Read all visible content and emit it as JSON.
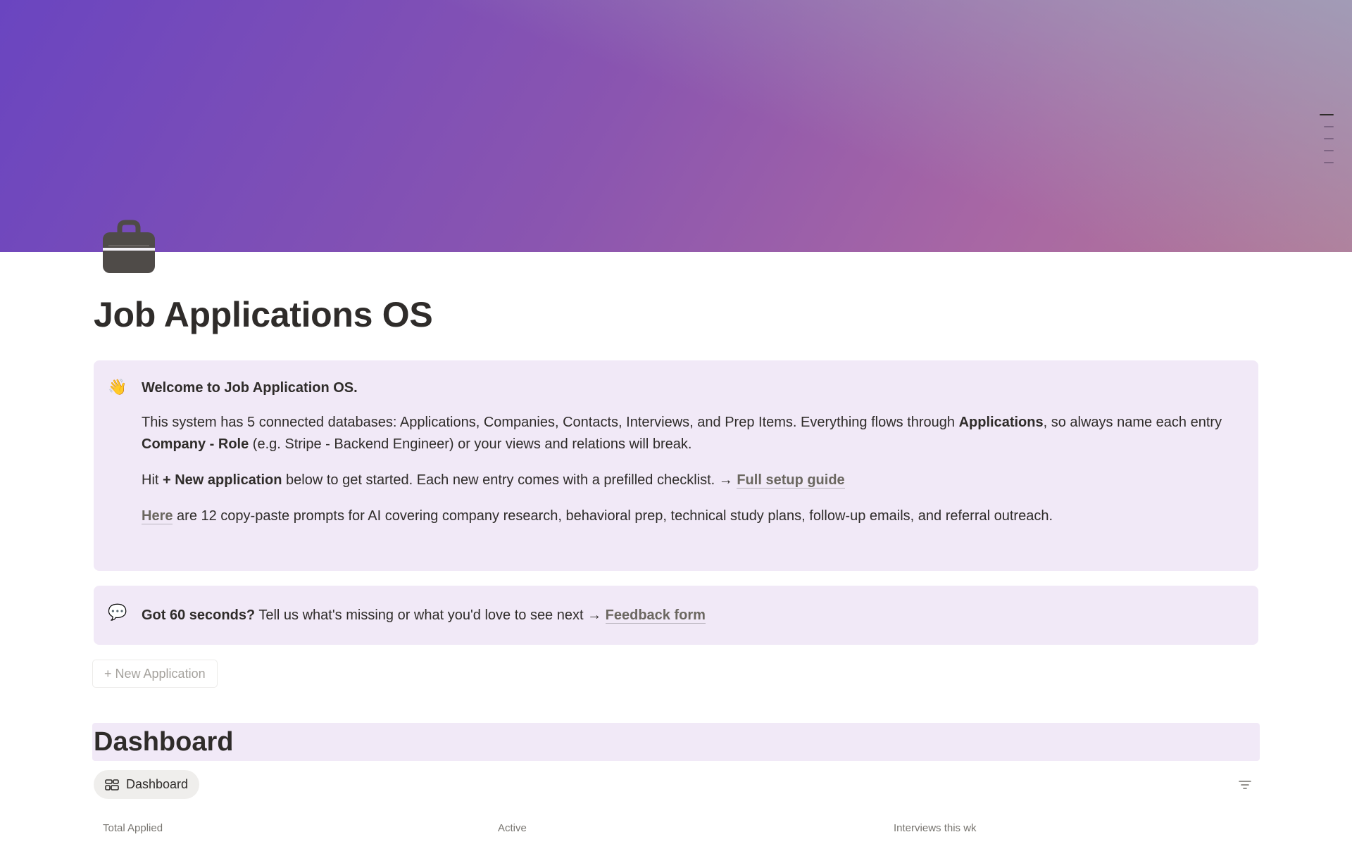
{
  "cover": {
    "toc_items": 5
  },
  "page": {
    "icon": "briefcase-icon",
    "title": "Job Applications OS"
  },
  "welcome_callout": {
    "emoji": "👋",
    "heading": "Welcome to Job Application OS.",
    "p1_a": "This system has 5 connected databases: Applications, Companies, Contacts, Interviews, and Prep Items. Everything flows through ",
    "p1_b": "Applications",
    "p1_c": ", so always name each entry ",
    "p1_d": "Company - Role",
    "p1_e": " (e.g. Stripe - Backend Engineer) or your views and relations will break.",
    "p2_a": "Hit ",
    "p2_b": "+ New application",
    "p2_c": " below to get started. Each new entry comes with a prefilled checklist. → ",
    "p2_link": "Full setup guide",
    "p3_link": "Here",
    "p3_b": " are 12 copy-paste prompts for AI covering company research, behavioral prep, technical study plans, follow-up emails, and referral outreach."
  },
  "feedback_callout": {
    "emoji": "💬",
    "bold": "Got 60 seconds?",
    "text": " Tell us what's missing or what you'd love to see next → ",
    "link": "Feedback form"
  },
  "new_application_button": "+ New Application",
  "dashboard": {
    "heading": "Dashboard",
    "view_tab": "Dashboard",
    "stats": [
      "Total Applied",
      "Active",
      "Interviews this wk"
    ]
  },
  "colors": {
    "callout_bg": "#f1e9f7",
    "text": "#2f2c2a",
    "link": "#6b6760"
  }
}
